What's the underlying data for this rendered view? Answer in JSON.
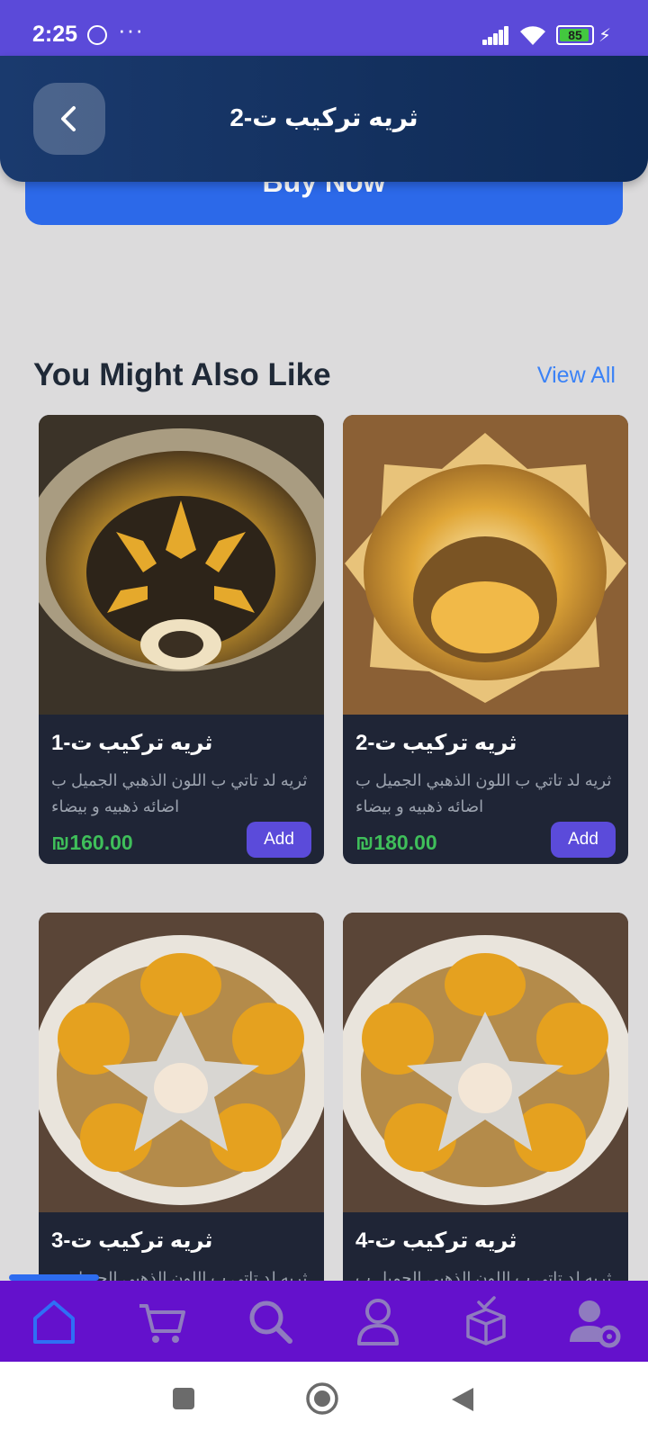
{
  "status_bar": {
    "time": "2:25",
    "battery": "85",
    "icons": [
      "whatsapp-icon",
      "more-dots-icon",
      "signal-icon",
      "wifi-icon",
      "battery-icon",
      "charging-bolt-icon"
    ]
  },
  "header": {
    "title": "ثريه تركيب ت-2",
    "back_icon": "chevron-left-icon"
  },
  "buy_now": {
    "label": "Buy Now"
  },
  "section": {
    "title": "You Might Also Like",
    "view_all": "View All"
  },
  "products": [
    {
      "name": "ثريه تركيب ت-1",
      "description": "ثريه لد تاتي ب اللون الذهبي الجميل ب اضائه ذهبيه و بيضاء",
      "price": "₪160.00",
      "add_label": "Add"
    },
    {
      "name": "ثريه تركيب ت-2",
      "description": "ثريه لد تاتي ب اللون الذهبي الجميل ب اضائه ذهبيه و بيضاء",
      "price": "₪180.00",
      "add_label": "Add"
    },
    {
      "name": "ثريه تركيب ت-3",
      "description": "ثريه لد تاتي ب اللون الذهبي الجميل ب",
      "price": "",
      "add_label": ""
    },
    {
      "name": "ثريه تركيب ت-4",
      "description": "ثريه لد تاتي ب اللون الذهبي الجميل ب",
      "price": "",
      "add_label": ""
    }
  ],
  "bottom_nav": {
    "items": [
      "home-icon",
      "cart-icon",
      "search-icon",
      "profile-icon",
      "orders-icon",
      "settings-user-icon"
    ],
    "active": "home-icon"
  },
  "colors": {
    "status_bar": "#5b4ad9",
    "header": "#13305e",
    "accent": "#5b4bda",
    "price": "#3fbf5a",
    "bottom_nav": "#6411cc",
    "link": "#3b82f6"
  }
}
